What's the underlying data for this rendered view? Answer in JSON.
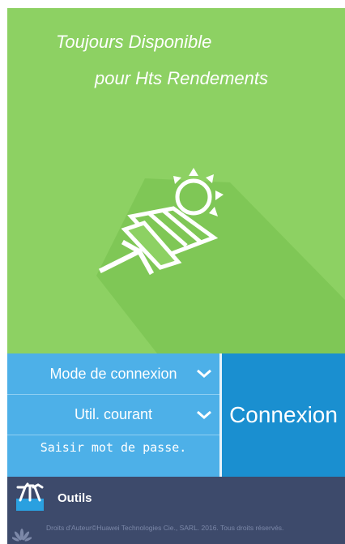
{
  "hero": {
    "tagline_line1": "Toujours Disponible",
    "tagline_line2": "pour Hts Rendements",
    "background_color": "#8dd163"
  },
  "login": {
    "mode_label": "Mode de connexion",
    "user_label": "Util. courant",
    "password_placeholder": "Saisir mot de passe.",
    "connect_label": "Connexion"
  },
  "tools": {
    "label": "Outils",
    "icon": "tools-icon"
  },
  "footer": {
    "copyright": "Droits d'Auteur©Huawei Technologies Cie., SARL. 2016. Tous droits réservés.",
    "icon": "huawei-logo-icon"
  },
  "colors": {
    "hero_green": "#8dd163",
    "field_blue": "#4db0e8",
    "button_blue": "#1a8fd0",
    "bar_navy": "#3d4a6b"
  }
}
